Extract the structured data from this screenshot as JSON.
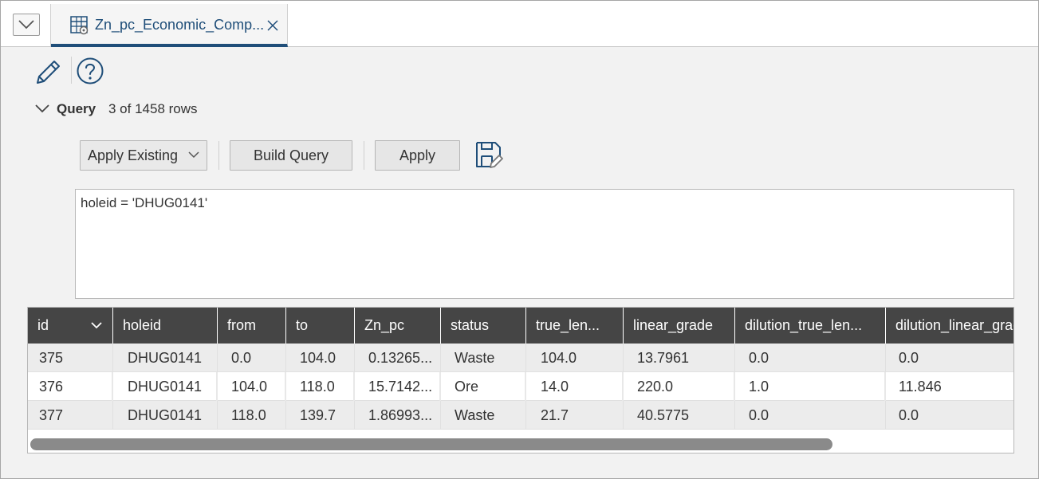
{
  "tab": {
    "title": "Zn_pc_Economic_Comp...",
    "menu_icon": "chevron-down-icon",
    "icon": "table-settings-icon",
    "close_icon": "close-icon"
  },
  "toolbar": {
    "edit_icon": "pencil-icon",
    "help_icon": "help-icon"
  },
  "query": {
    "label": "Query",
    "count": "3 of 1458 rows",
    "apply_existing_label": "Apply Existing",
    "build_query_label": "Build Query",
    "apply_label": "Apply",
    "save_icon": "save-edit-icon",
    "text": "holeid = 'DHUG0141'"
  },
  "grid": {
    "columns": [
      "id",
      "holeid",
      "from",
      "to",
      "Zn_pc",
      "status",
      "true_len...",
      "linear_grade",
      "dilution_true_len...",
      "dilution_linear_grad"
    ],
    "rows": [
      [
        "375",
        "DHUG0141",
        "0.0",
        "104.0",
        "0.13265...",
        "Waste",
        "104.0",
        "13.7961",
        "0.0",
        "0.0"
      ],
      [
        "376",
        "DHUG0141",
        "104.0",
        "118.0",
        "15.7142...",
        "Ore",
        "14.0",
        "220.0",
        "1.0",
        "11.846"
      ],
      [
        "377",
        "DHUG0141",
        "118.0",
        "139.7",
        "1.86993...",
        "Waste",
        "21.7",
        "40.5775",
        "0.0",
        "0.0"
      ]
    ]
  },
  "colors": {
    "accent": "#1f4e79",
    "header_bg": "#454545",
    "row_alt": "#ececec"
  }
}
